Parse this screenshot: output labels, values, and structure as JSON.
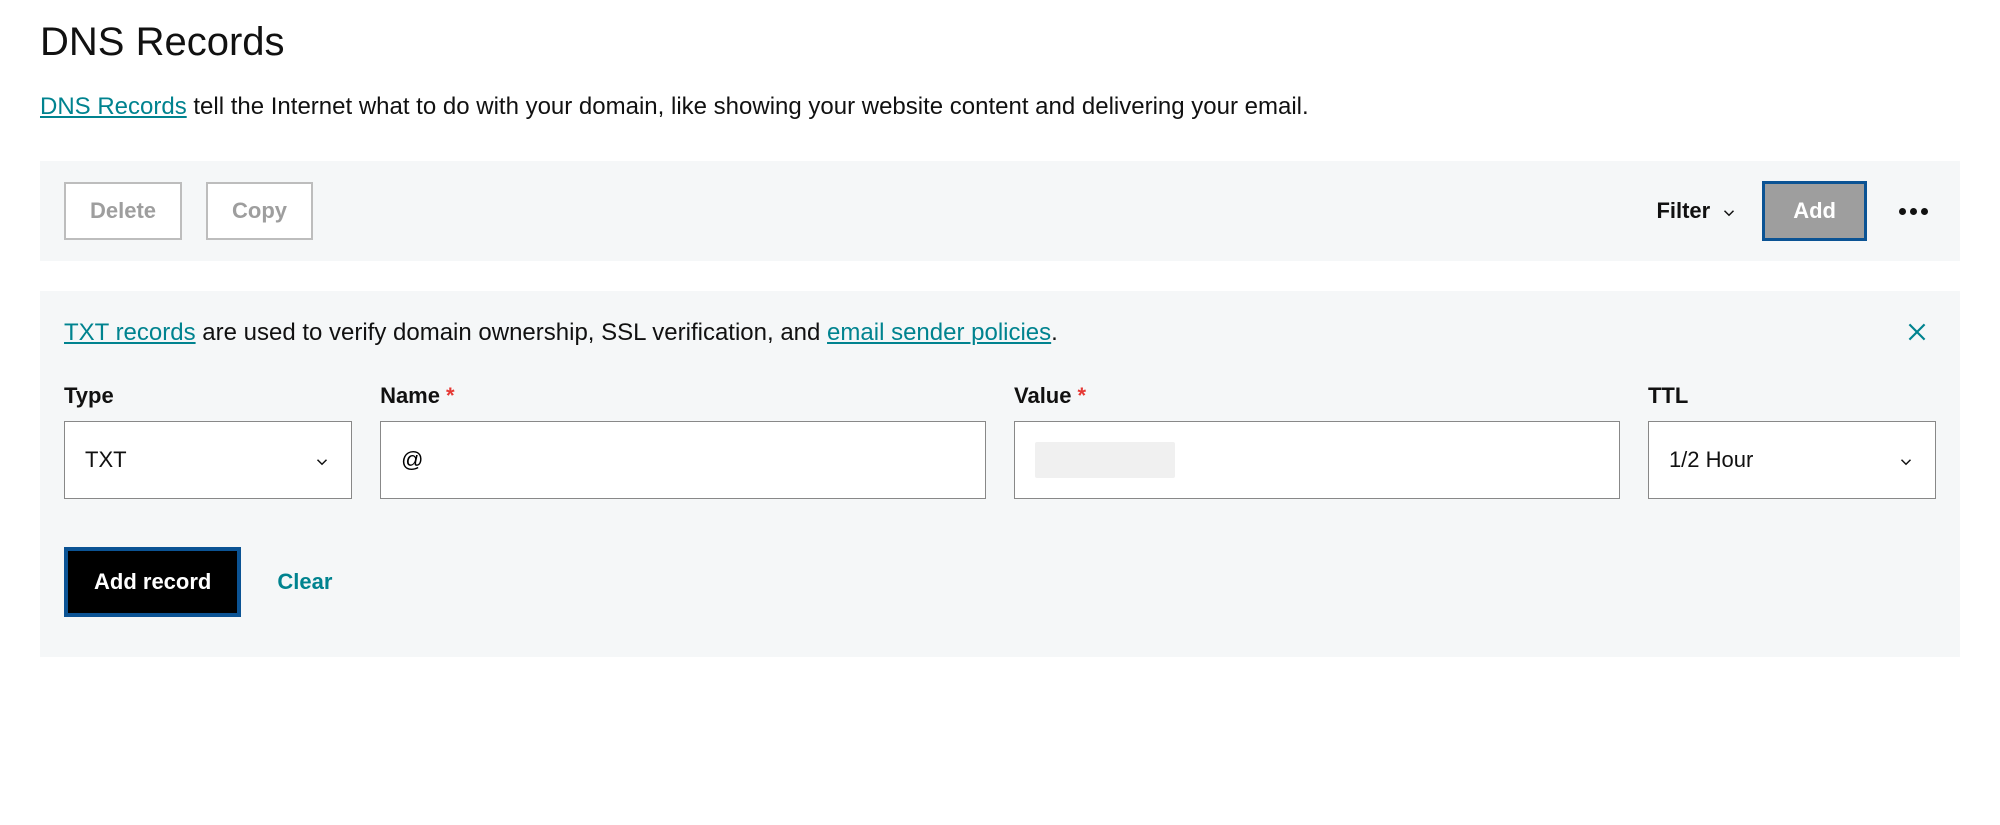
{
  "header": {
    "title": "DNS Records",
    "description_link": "DNS Records",
    "description_rest": " tell the Internet what to do with your domain, like showing your website content and delivering your email."
  },
  "toolbar": {
    "delete_label": "Delete",
    "copy_label": "Copy",
    "filter_label": "Filter",
    "add_label": "Add"
  },
  "info": {
    "txt_link": "TXT records",
    "mid_text": " are used to verify domain ownership, SSL verification, and ",
    "policies_link": "email sender policies",
    "end_text": "."
  },
  "form": {
    "type_label": "Type",
    "type_value": "TXT",
    "name_label": "Name",
    "name_value": "@",
    "value_label": "Value",
    "value_value": "",
    "ttl_label": "TTL",
    "ttl_value": "1/2 Hour",
    "add_record_label": "Add record",
    "clear_label": "Clear"
  }
}
